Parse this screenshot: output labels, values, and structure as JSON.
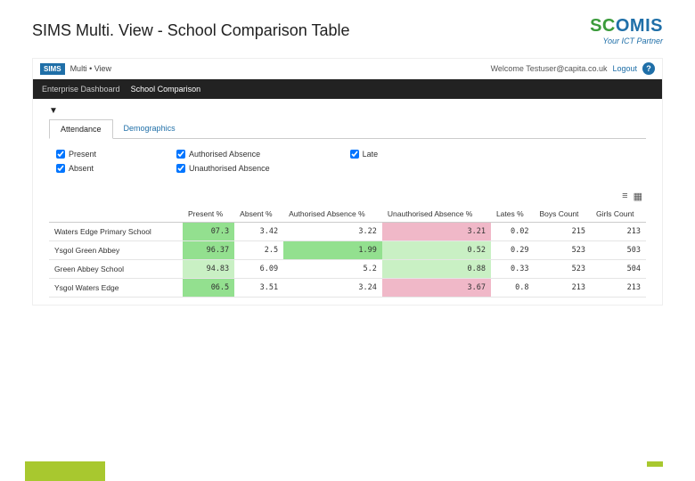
{
  "slide": {
    "title": "SIMS Multi. View - School Comparison Table"
  },
  "branding": {
    "logo_s": "SC",
    "logo_c": "OMIS",
    "tagline": "Your ICT Partner"
  },
  "app": {
    "badge": "SIMS",
    "name": "Multi • View",
    "welcome": "Welcome Testuser@capita.co.uk",
    "logout": "Logout",
    "help": "?"
  },
  "nav": {
    "items": [
      "Enterprise Dashboard",
      "School Comparison"
    ],
    "active": 1
  },
  "tabs": {
    "items": [
      "Attendance",
      "Demographics"
    ],
    "active": 0
  },
  "filters": {
    "col0": [
      {
        "label": "Present",
        "checked": true
      },
      {
        "label": "Absent",
        "checked": true
      }
    ],
    "col1": [
      {
        "label": "Authorised Absence",
        "checked": true
      },
      {
        "label": "Unauthorised Absence",
        "checked": true
      }
    ],
    "col2": [
      {
        "label": "Late",
        "checked": true
      }
    ]
  },
  "toolbar": {
    "list": "≡",
    "grid": "▦"
  },
  "table": {
    "headers": [
      "",
      "Present %",
      "Absent %",
      "Authorised Absence %",
      "Unauthorised Absence %",
      "Lates %",
      "Boys Count",
      "Girls Count"
    ],
    "rows": [
      {
        "name": "Waters Edge Primary School",
        "cells": [
          "07.3",
          "3.42",
          "3.22",
          "3.21",
          "0.02",
          "215",
          "213"
        ],
        "classes": [
          "g",
          "",
          "",
          "p",
          "",
          "",
          " "
        ]
      },
      {
        "name": "Ysgol Green Abbey",
        "cells": [
          "96.37",
          "2.5",
          "1.99",
          "0.52",
          "0.29",
          "523",
          "503"
        ],
        "classes": [
          "g",
          "",
          "g",
          "lg",
          "",
          "",
          ""
        ]
      },
      {
        "name": "Green Abbey School",
        "cells": [
          "94.83",
          "6.09",
          "5.2",
          "0.88",
          "0.33",
          "523",
          "504"
        ],
        "classes": [
          "lg",
          "",
          "",
          "lg",
          "",
          "",
          ""
        ]
      },
      {
        "name": "Ysgol Waters Edge",
        "cells": [
          "06.5",
          "3.51",
          "3.24",
          "3.67",
          "0.8",
          "213",
          "213"
        ],
        "classes": [
          "g",
          "",
          "",
          "p",
          "",
          "",
          ""
        ]
      }
    ]
  }
}
